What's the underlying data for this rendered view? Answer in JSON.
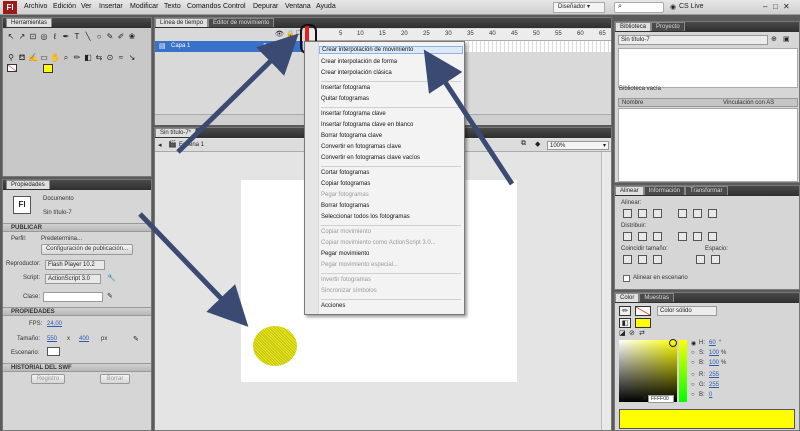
{
  "app": {
    "logo_text": "Fl"
  },
  "menu": [
    "Archivo",
    "Edición",
    "Ver",
    "Insertar",
    "Modificar",
    "Texto",
    "Comandos",
    "Control",
    "Depurar",
    "Ventana",
    "Ayuda"
  ],
  "workspace": {
    "label": "Diseñador",
    "cs_live": "CS Live"
  },
  "tools_panel": {
    "title": "Herramientas"
  },
  "timeline": {
    "tab_timeline": "Línea de tiempo",
    "tab_motion": "Editor de movimiento",
    "layer_name": "Capa 1",
    "frame_numbers": [
      "5",
      "10",
      "15",
      "20",
      "25",
      "30",
      "35",
      "40",
      "45",
      "50",
      "55",
      "60",
      "65"
    ]
  },
  "document": {
    "tab": "Sin título-7*",
    "scene": "Escena 1",
    "zoom": "100%"
  },
  "context_menu": {
    "items": [
      {
        "label": "Crear interpolación de movimiento",
        "state": "highlight"
      },
      {
        "label": "Crear interpolación de forma",
        "state": "normal"
      },
      {
        "label": "Crear interpolación clásica",
        "state": "normal"
      },
      {
        "sep": true
      },
      {
        "label": "Insertar fotograma",
        "state": "normal"
      },
      {
        "label": "Quitar fotogramas",
        "state": "normal"
      },
      {
        "sep": true
      },
      {
        "label": "Insertar fotograma clave",
        "state": "normal"
      },
      {
        "label": "Insertar fotograma clave en blanco",
        "state": "normal"
      },
      {
        "label": "Borrar fotograma clave",
        "state": "normal"
      },
      {
        "label": "Convertir en fotogramas clave",
        "state": "normal"
      },
      {
        "label": "Convertir en fotogramas clave vacíos",
        "state": "normal"
      },
      {
        "sep": true
      },
      {
        "label": "Cortar fotogramas",
        "state": "normal"
      },
      {
        "label": "Copiar fotogramas",
        "state": "normal"
      },
      {
        "label": "Pegar fotogramas",
        "state": "disabled"
      },
      {
        "label": "Borrar fotogramas",
        "state": "normal"
      },
      {
        "label": "Seleccionar todos los fotogramas",
        "state": "normal"
      },
      {
        "sep": true
      },
      {
        "label": "Copiar movimiento",
        "state": "disabled"
      },
      {
        "label": "Copiar movimiento como ActionScript 3.0...",
        "state": "disabled"
      },
      {
        "label": "Pegar movimiento",
        "state": "normal"
      },
      {
        "label": "Pegar movimiento especial...",
        "state": "disabled"
      },
      {
        "sep": true
      },
      {
        "label": "Invertir fotogramas",
        "state": "disabled"
      },
      {
        "label": "Sincronizar símbolos",
        "state": "disabled"
      },
      {
        "sep": true
      },
      {
        "label": "Acciones",
        "state": "normal"
      }
    ]
  },
  "properties": {
    "title": "Propiedades",
    "doc_icon": "Fl",
    "doc_type": "Documento",
    "doc_name": "Sin título-7",
    "publish_header": "PUBLICAR",
    "profile_label": "Perfil:",
    "profile_value": "Predetermina...",
    "publish_settings_btn": "Configuración de publicación...",
    "player_label": "Reproductor:",
    "player_value": "Flash Player 10.2",
    "script_label": "Script:",
    "script_value": "ActionScript 3.0",
    "class_label": "Clase:",
    "props_header": "PROPIEDADES",
    "fps_label": "FPS:",
    "fps_value": "24,00",
    "size_label": "Tamaño:",
    "width": "550",
    "x_sep": "x",
    "height": "400",
    "unit": "px",
    "stage_label": "Escenario:",
    "swf_header": "HISTORIAL DEL SWF",
    "log_btn": "Registro",
    "clear_btn": "Borrar"
  },
  "library": {
    "tab_library": "Biblioteca",
    "tab_project": "Proyecto",
    "doc_select": "Sin título-7",
    "empty": "Biblioteca vacía",
    "col_name": "Nombre",
    "col_linkage": "Vinculación con AS"
  },
  "align": {
    "tab_align": "Alinear",
    "tab_info": "Información",
    "tab_transform": "Transformar",
    "align_label": "Alinear:",
    "distribute_label": "Distribuir:",
    "match_label": "Coincidir tamaño:",
    "space_label": "Espacio:",
    "stage_check": "Alinear en escenario"
  },
  "color": {
    "tab_color": "Color",
    "tab_swatches": "Muestras",
    "fill_type": "Color sólido",
    "h_label": "H:",
    "h_value": "60",
    "h_unit": "°",
    "s_label": "S:",
    "s_value": "100",
    "s_unit": "%",
    "b_label": "B:",
    "b_value": "100",
    "b_unit": "%",
    "r_label": "R:",
    "r_value": "255",
    "g_label": "G:",
    "g_value": "255",
    "bl_label": "B:",
    "bl_value": "0",
    "hex_prefix": "#",
    "hex_value": "FFFF00",
    "fill_color": "#ffff00"
  },
  "colors": {
    "accent": "#3a72c9",
    "arrow": "#3a4a72"
  }
}
